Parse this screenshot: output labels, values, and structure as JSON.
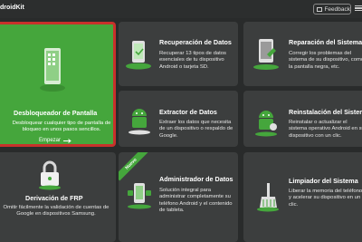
{
  "app": {
    "title": "droidKit",
    "feedback_label": "Feedback"
  },
  "cards": {
    "unlock": {
      "title": "Desbloqueador de Pantalla",
      "desc": "Desbloquear cualquier tipo de pantalla de bloqueo en unos pasos sencillos.",
      "start": "Empezar"
    },
    "frp": {
      "title": "Derivación de FRP",
      "desc": "Omitir fácilmente la validación de cuentas de Google en dispositivos Samsung."
    },
    "recovery": {
      "title": "Recuperación de Datos",
      "desc": "Recuperar 13 tipos de datos esenciales de tu dispositivo Android o tarjeta SD."
    },
    "extractor": {
      "title": "Extractor de Datos",
      "desc": "Extraer los datos que necesita de un dispositivo o respaldo de Google."
    },
    "manager": {
      "title": "Administrador de Datos",
      "desc": "Solución integral para administrar completamente su teléfono Android y el contenido de tableta.",
      "badge": "Nuevo"
    },
    "repair": {
      "title": "Reparación del Sistema",
      "desc": "Corregir los problemas del sistema de su dispositivo, como la pantalla negra, etc."
    },
    "reinstall": {
      "title": "Reinstalación del Sistema",
      "desc": "Reinstalar o actualizar el sistema operativo Android en su dispositivo con un clic."
    },
    "cleaner": {
      "title": "Limpiador del Sistema",
      "desc": "Liberar la memoria del teléfono y acelerar su dispositivo en un clic."
    }
  },
  "colors": {
    "accent": "#45a63c",
    "highlight_border": "#c8312b",
    "card_bg": "#3c3e3e",
    "page_bg": "#292b2b"
  }
}
